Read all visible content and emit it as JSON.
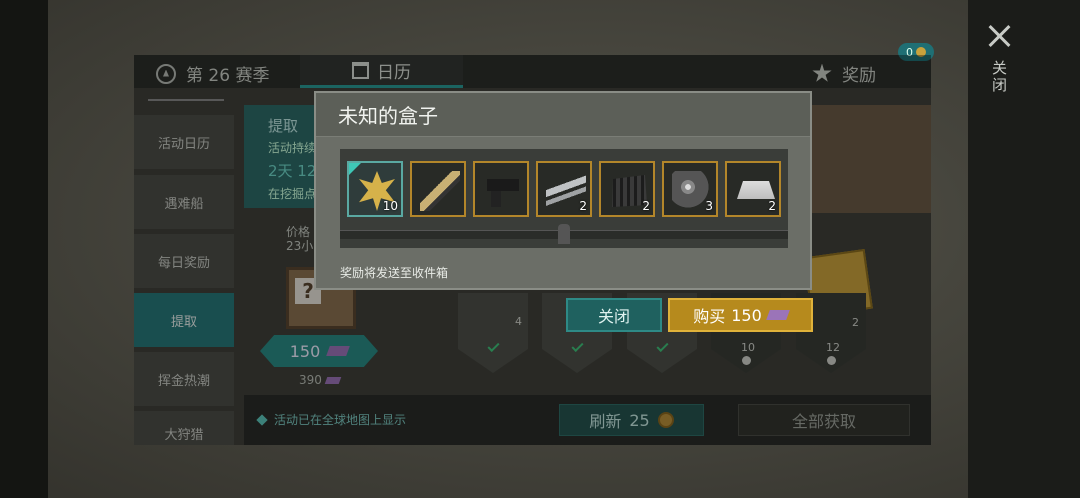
{
  "window": {
    "close_vertical_label": "关闭"
  },
  "topbar": {
    "season_label": "第 26 赛季",
    "calendar_tab": "日历",
    "reward_tab": "奖励",
    "reward_badge_count": "0"
  },
  "sidebar": {
    "items": [
      {
        "label": "活动日历"
      },
      {
        "label": "遇难船"
      },
      {
        "label": "每日奖励"
      },
      {
        "label": "提取"
      },
      {
        "label": "挥金热潮"
      },
      {
        "label": "大狩猎"
      }
    ],
    "active_index": 3
  },
  "event": {
    "title": "提取",
    "duration_label": "活动持续",
    "time_left": "2天 12",
    "location_text": "在挖掘点",
    "price_label": "价格",
    "price_sub": "23小",
    "price_value": "150",
    "price_old": "390"
  },
  "rewards_row": {
    "counts": [
      "4",
      "10",
      "12",
      "2"
    ]
  },
  "bottombar": {
    "notice": "活动已在全球地图上显示",
    "refresh_label": "刷新",
    "refresh_cost": "25",
    "get_all_label": "全部获取"
  },
  "popup": {
    "title": "未知的盒子",
    "items": [
      {
        "icon": "golden-star-icon",
        "count": "10"
      },
      {
        "icon": "rifle-icon",
        "count": ""
      },
      {
        "icon": "pistol-icon",
        "count": ""
      },
      {
        "icon": "weapon-parts-icon",
        "count": "2"
      },
      {
        "icon": "metal-plate-icon",
        "count": "2"
      },
      {
        "icon": "ore-icon",
        "count": "3"
      },
      {
        "icon": "silver-ingot-icon",
        "count": "2"
      }
    ],
    "note": "奖励将发送至收件箱",
    "close_label": "关闭",
    "buy_label": "购买",
    "buy_price": "150"
  },
  "colors": {
    "accent_teal": "#27797a",
    "buy_gold": "#b68a1d",
    "item_border_gold": "#b3862a"
  }
}
